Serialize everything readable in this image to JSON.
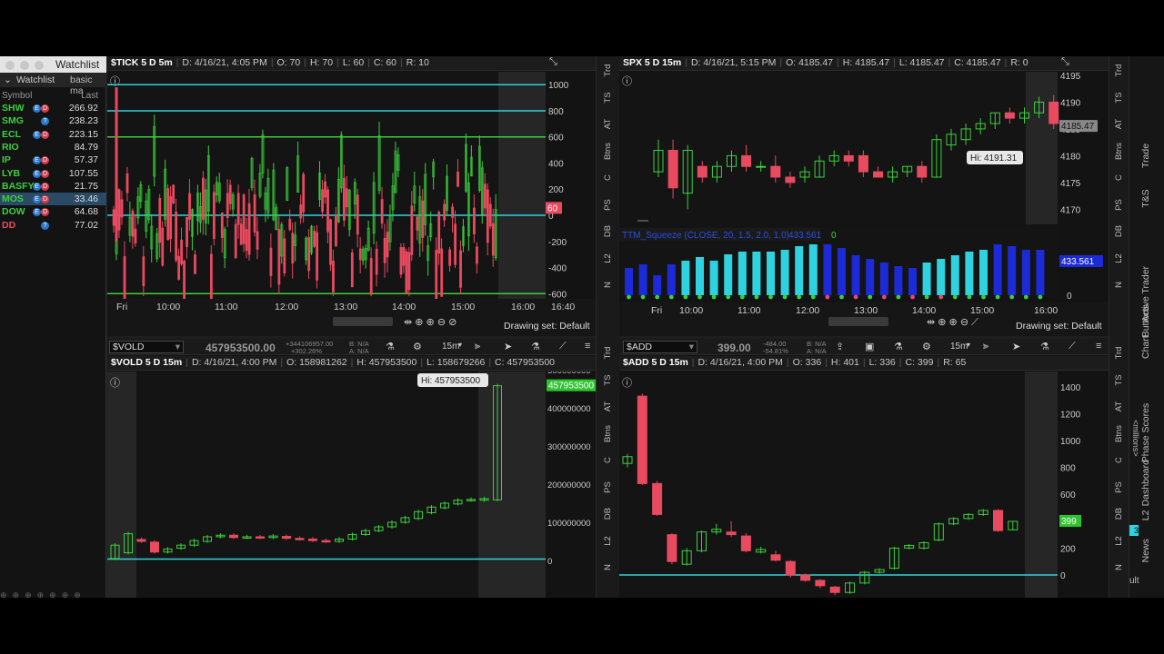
{
  "watchlist": {
    "title": "Watchlist",
    "tab1": "Watchlist",
    "tab2": "basic ma",
    "col_symbol": "Symbol",
    "col_last": "Last",
    "rows": [
      {
        "symbol": "SHW",
        "last": "266.92",
        "color": "#3ccf3c",
        "badges": [
          "blue",
          "red"
        ]
      },
      {
        "symbol": "SMG",
        "last": "238.23",
        "color": "#3ccf3c",
        "badges": [
          "help"
        ]
      },
      {
        "symbol": "ECL",
        "last": "223.15",
        "color": "#3ccf3c",
        "badges": [
          "blue",
          "red"
        ]
      },
      {
        "symbol": "RIO",
        "last": "84.79",
        "color": "#3ccf3c",
        "badges": []
      },
      {
        "symbol": "IP",
        "last": "57.37",
        "color": "#3ccf3c",
        "badges": [
          "blue",
          "red"
        ]
      },
      {
        "symbol": "LYB",
        "last": "107.55",
        "color": "#3ccf3c",
        "badges": [
          "blue",
          "red"
        ]
      },
      {
        "symbol": "BASFY",
        "last": "21.75",
        "color": "#3ccf3c",
        "badges": [
          "blue",
          "red"
        ]
      },
      {
        "symbol": "MOS",
        "last": "33.46",
        "color": "#3ccf3c",
        "badges": [
          "blue",
          "red"
        ],
        "selected": true
      },
      {
        "symbol": "DOW",
        "last": "64.68",
        "color": "#3ccf3c",
        "badges": [
          "blue",
          "red"
        ]
      },
      {
        "symbol": "DD",
        "last": "77.02",
        "color": "#e84a5f",
        "badges": [
          "help"
        ]
      }
    ]
  },
  "tick": {
    "header": {
      "symbol": "$TICK 5 D 5m",
      "date": "D: 4/16/21, 4:05 PM",
      "open": "O: 70",
      "high": "H: 70",
      "low": "L: 60",
      "close": "C: 60",
      "range": "R: 10"
    },
    "y_labels": [
      "1000",
      "800",
      "600",
      "400",
      "200",
      "0",
      "-200",
      "-400",
      "-600"
    ],
    "last_tag": "60",
    "x_labels": [
      "Fri",
      "10:00",
      "11:00",
      "12:00",
      "13:00",
      "14:00",
      "15:00",
      "16:00",
      "16:40"
    ],
    "drawing_set": "Drawing set: Default"
  },
  "spx": {
    "header": {
      "symbol": "SPX 5 D 15m",
      "date": "D: 4/16/21, 5:15 PM",
      "open": "O: 4185.47",
      "high": "H: 4185.47",
      "low": "L: 4185.47",
      "close": "C: 4185.47",
      "range": "R: 0"
    },
    "y_labels": [
      "4195",
      "4190",
      "4185",
      "4180",
      "4175",
      "4170"
    ],
    "hi_bubble": "Hi: 4191.31",
    "last_tag": "4185.47",
    "squeeze_label": "TTM_Squeeze (CLOSE, 20, 1.5, 2.0, 1.0)",
    "squeeze_value": "433.561",
    "squeeze_zero": "0",
    "squeeze_tag": "433.561",
    "squeeze_axis_zero": "0",
    "x_labels": [
      "Fri",
      "10:00",
      "11:00",
      "12:00",
      "13:00",
      "14:00",
      "15:00",
      "16:00"
    ],
    "drawing_set": "Drawing set: Default"
  },
  "vold": {
    "symbol_box": "$VOLD",
    "price": "457953500.00",
    "change1": "+344106957.00",
    "change2": "+302.26%",
    "bid": "B: N/A",
    "ask": "A: N/A",
    "timeframe": "15m",
    "header": {
      "symbol": "$VOLD 5 D 15m",
      "date": "D: 4/16/21, 4:00 PM",
      "open": "O: 158981262",
      "high": "H: 457953500",
      "low": "L: 158679266",
      "close": "C: 457953500"
    },
    "y_labels": [
      "500000000",
      "400000000",
      "300000000",
      "200000000",
      "100000000",
      "0"
    ],
    "hi_bubble": "Hi: 457953500",
    "last_tag": "457953500"
  },
  "add": {
    "symbol_box": "$ADD",
    "price": "399.00",
    "change1": "-484.00",
    "change2": "-54.81%",
    "bid": "B: N/A",
    "ask": "A: N/A",
    "timeframe": "15m",
    "header": {
      "symbol": "$ADD 5 D 15m",
      "date": "D: 4/16/21, 4:00 PM",
      "open": "O: 336",
      "high": "H: 401",
      "low": "L: 336",
      "close": "C: 399",
      "range": "R: 65"
    },
    "y_labels": [
      "1400",
      "1200",
      "1000",
      "800",
      "600",
      "400",
      "200",
      "0",
      "-200"
    ],
    "last_tag": "399"
  },
  "side_tabs": [
    "Trd",
    "TS",
    "AT",
    "Btns",
    "C",
    "PS",
    "DB",
    "L2",
    "N"
  ],
  "right_tabs": [
    "Trade",
    "T&S",
    "Active Trader",
    "Buttons",
    "Chart",
    "Phase Scores",
    "Dashboard",
    "L2",
    "News"
  ],
  "right_misc": "<millions>",
  "right_misc2": "ult",
  "right_misc3": "3",
  "colors": {
    "up": "#3ccf3c",
    "down": "#e84a5f",
    "cyan": "#2fd3df",
    "bg": "#131313"
  }
}
